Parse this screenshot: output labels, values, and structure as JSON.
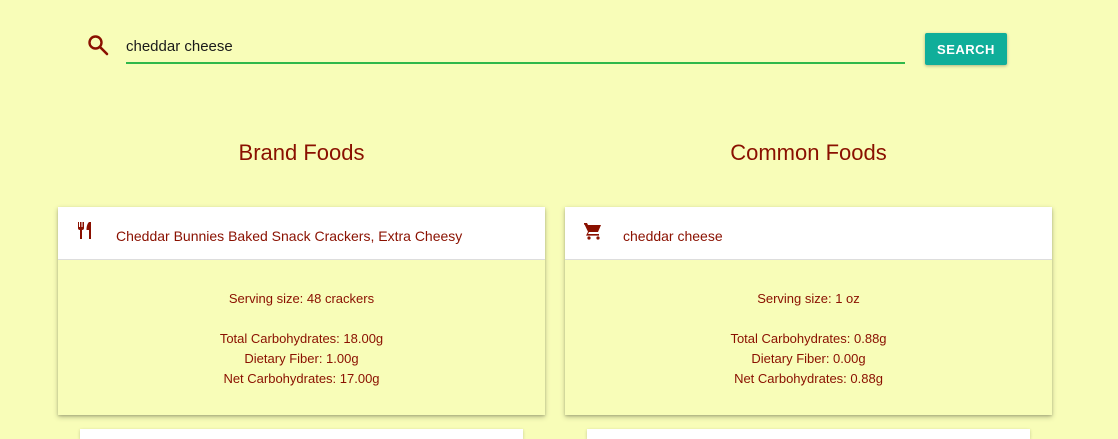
{
  "search": {
    "value": "cheddar cheese",
    "placeholder": "",
    "button_label": "SEARCH"
  },
  "colors": {
    "background": "#f8fdb8",
    "text": "#8a1000",
    "accent": "#0fae9a",
    "input_underline": "#2fb84a"
  },
  "columns": [
    {
      "title": "Brand Foods",
      "cards": [
        {
          "icon": "fork-knife-icon",
          "name": "Cheddar Bunnies Baked Snack Crackers, Extra Cheesy",
          "serving": "Serving size: 48 crackers",
          "total_carbs": "Total Carbohydrates: 18.00g",
          "fiber": "Dietary Fiber: 1.00g",
          "net_carbs": "Net Carbohydrates: 17.00g"
        }
      ]
    },
    {
      "title": "Common Foods",
      "cards": [
        {
          "icon": "shopping-cart-icon",
          "name": "cheddar cheese",
          "serving": "Serving size: 1 oz",
          "total_carbs": "Total Carbohydrates: 0.88g",
          "fiber": "Dietary Fiber: 0.00g",
          "net_carbs": "Net Carbohydrates: 0.88g"
        }
      ]
    }
  ]
}
